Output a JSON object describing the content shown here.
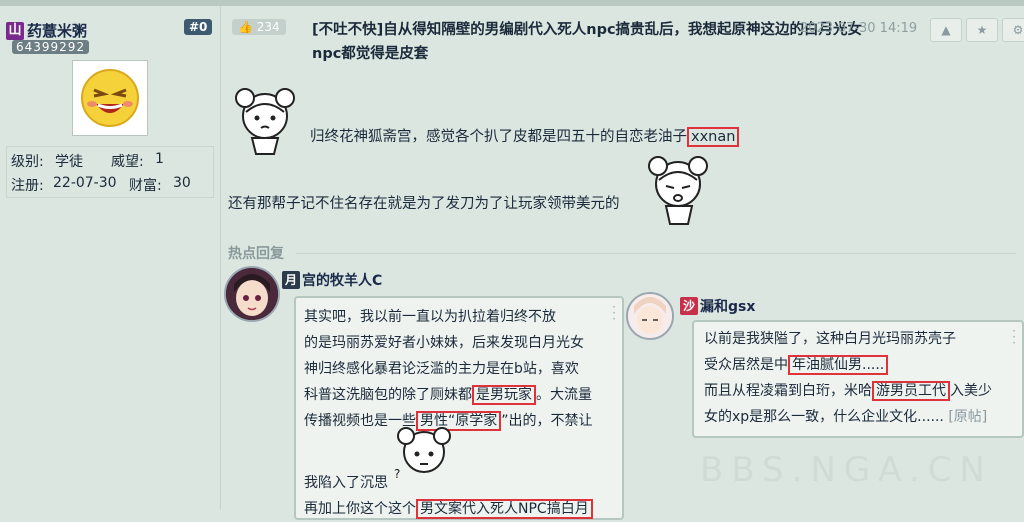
{
  "author": {
    "badge": "山",
    "name": "药薏米粥",
    "floor": "#0",
    "uid": "64399292",
    "level_label": "级别:",
    "level_value": "学徒",
    "prestige_label": "威望:",
    "prestige_value": "1",
    "reg_label": "注册:",
    "reg_value": "22-07-30",
    "wealth_label": "财富:",
    "wealth_value": "30"
  },
  "post": {
    "likes": "234",
    "title": "[不吐不快]自从得知隔壁的男编剧代入死人npc搞贵乱后，我想起原神这边的白月光女npc都觉得是皮套",
    "date": "2023-07-30 14:19",
    "line1_text": "归终花神狐斋宫，感觉各个扒了皮都是四五十的自恋老油子",
    "line1_hl": "xxnan",
    "line2_text": "还有那帮子记不住名存在就是为了发刀为了让玩家领带美元的"
  },
  "hot_replies_label": "热点回复",
  "reply1": {
    "badge": "月",
    "name": "宫的牧羊人C",
    "l1": "其实吧，我以前一直以为扒拉着归终不放",
    "l2": "的是玛丽苏爱好者小妹妹，后来发现白月光女",
    "l3": "神归终感化暴君论泛滥的主力是在b站，喜欢",
    "l4a": "科普这洗脑包的除了厕妹都",
    "l4hl": "是男玩家",
    "l4b": "。大流量",
    "l5a": "传播视频也是一些",
    "l5hl": "男性“原学家",
    "l5b": "”出的，不禁让",
    "l6": "我陷入了沉思",
    "l7a": "再加上你这个这个",
    "l7hl": "男文案代入死人NPC搞白月"
  },
  "reply2": {
    "badge": "沙",
    "name": "漏和gsx",
    "l1": "以前是我狭隘了，这种白月光玛丽苏壳子",
    "l2a": "受众居然是中",
    "l2hl": "年油腻仙男.....",
    "l3a": "而且从程凌霜到白珩，米哈",
    "l3hl": "游男员工代",
    "l3b": "入美少",
    "l4": "女的xp是那么一致，什么企业文化......",
    "orig": "[原帖]"
  },
  "watermark": "BBS.NGA.CN"
}
